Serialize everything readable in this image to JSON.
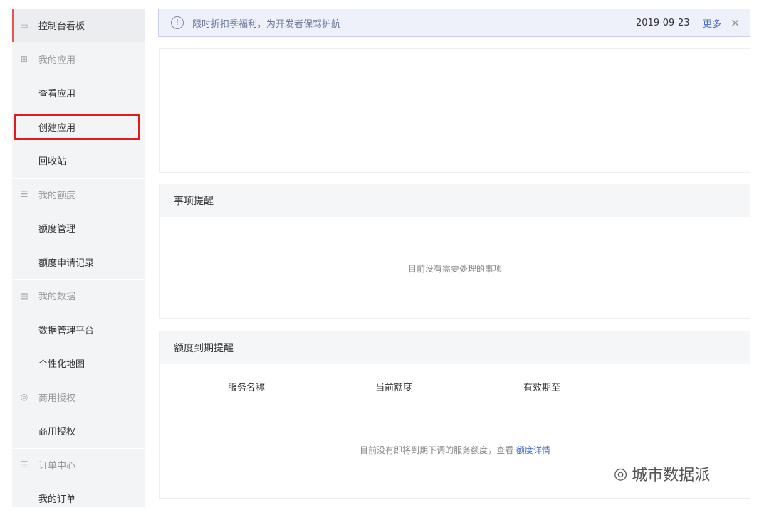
{
  "sidebar": {
    "items": [
      {
        "label": "控制台看板",
        "icon": "monitor-icon",
        "type": "active"
      },
      {
        "label": "我的应用",
        "icon": "grid-icon",
        "type": "group"
      },
      {
        "label": "查看应用",
        "type": "sub"
      },
      {
        "label": "创建应用",
        "type": "sub"
      },
      {
        "label": "回收站",
        "type": "sub"
      },
      {
        "label": "我的额度",
        "icon": "list-icon",
        "type": "group"
      },
      {
        "label": "额度管理",
        "type": "sub"
      },
      {
        "label": "额度申请记录",
        "type": "sub"
      },
      {
        "label": "我的数据",
        "icon": "id-card-icon",
        "type": "group"
      },
      {
        "label": "数据管理平台",
        "type": "sub"
      },
      {
        "label": "个性化地图",
        "type": "sub"
      },
      {
        "label": "商用授权",
        "icon": "badge-icon",
        "type": "group"
      },
      {
        "label": "商用授权",
        "type": "sub"
      },
      {
        "label": "订单中心",
        "icon": "list-icon",
        "type": "group"
      },
      {
        "label": "我的订单",
        "type": "sub"
      }
    ]
  },
  "banner": {
    "message": "限时折扣季福利，为开发者保驾护航",
    "date": "2019-09-23",
    "more": "更多",
    "close": "✕",
    "info": "!"
  },
  "reminders": {
    "title": "事项提醒",
    "empty": "目前没有需要处理的事项"
  },
  "quota": {
    "title": "额度到期提醒",
    "columns": [
      "服务名称",
      "当前额度",
      "有效期至"
    ],
    "empty": "目前没有即将到期下调的服务额度，查看",
    "link": "额度详情"
  },
  "watermark": "城市数据派"
}
